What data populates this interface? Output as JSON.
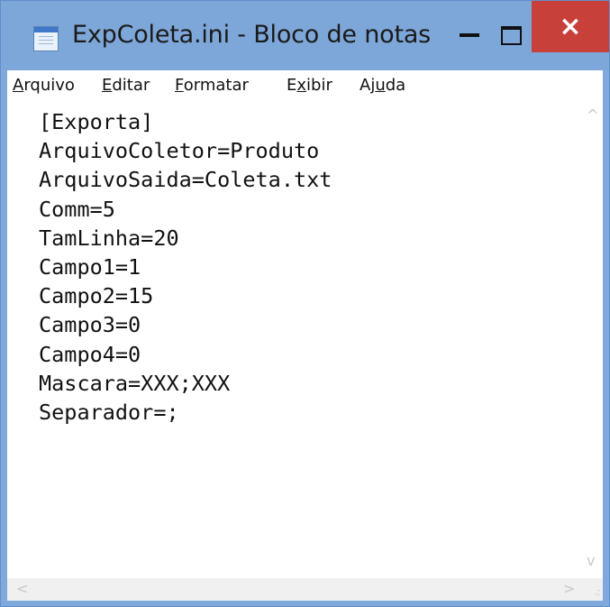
{
  "window": {
    "title": "ExpColeta.ini - Bloco de notas",
    "close_glyph": "×"
  },
  "menu": [
    {
      "pre": "",
      "key": "A",
      "post": "rquivo"
    },
    {
      "pre": "",
      "key": "E",
      "post": "ditar"
    },
    {
      "pre": "",
      "key": "F",
      "post": "ormatar"
    },
    {
      "pre": "E",
      "key": "x",
      "post": "ibir"
    },
    {
      "pre": "Aj",
      "key": "u",
      "post": "da"
    }
  ],
  "content": {
    "lines": [
      "[Exporta]",
      "ArquivoColetor=Produto",
      "ArquivoSaida=Coleta.txt",
      "Comm=5",
      "TamLinha=20",
      "Campo1=1",
      "Campo2=15",
      "Campo3=0",
      "Campo4=0",
      "Mascara=XXX;XXX",
      "Separador=;"
    ]
  },
  "scroll": {
    "up_glyph": "^",
    "down_glyph": "v",
    "left_glyph": "<",
    "right_glyph": ">",
    "grip_glyph": ".:"
  },
  "colors": {
    "titlebar": "#7ea7d9",
    "close_button": "#c7403a"
  }
}
